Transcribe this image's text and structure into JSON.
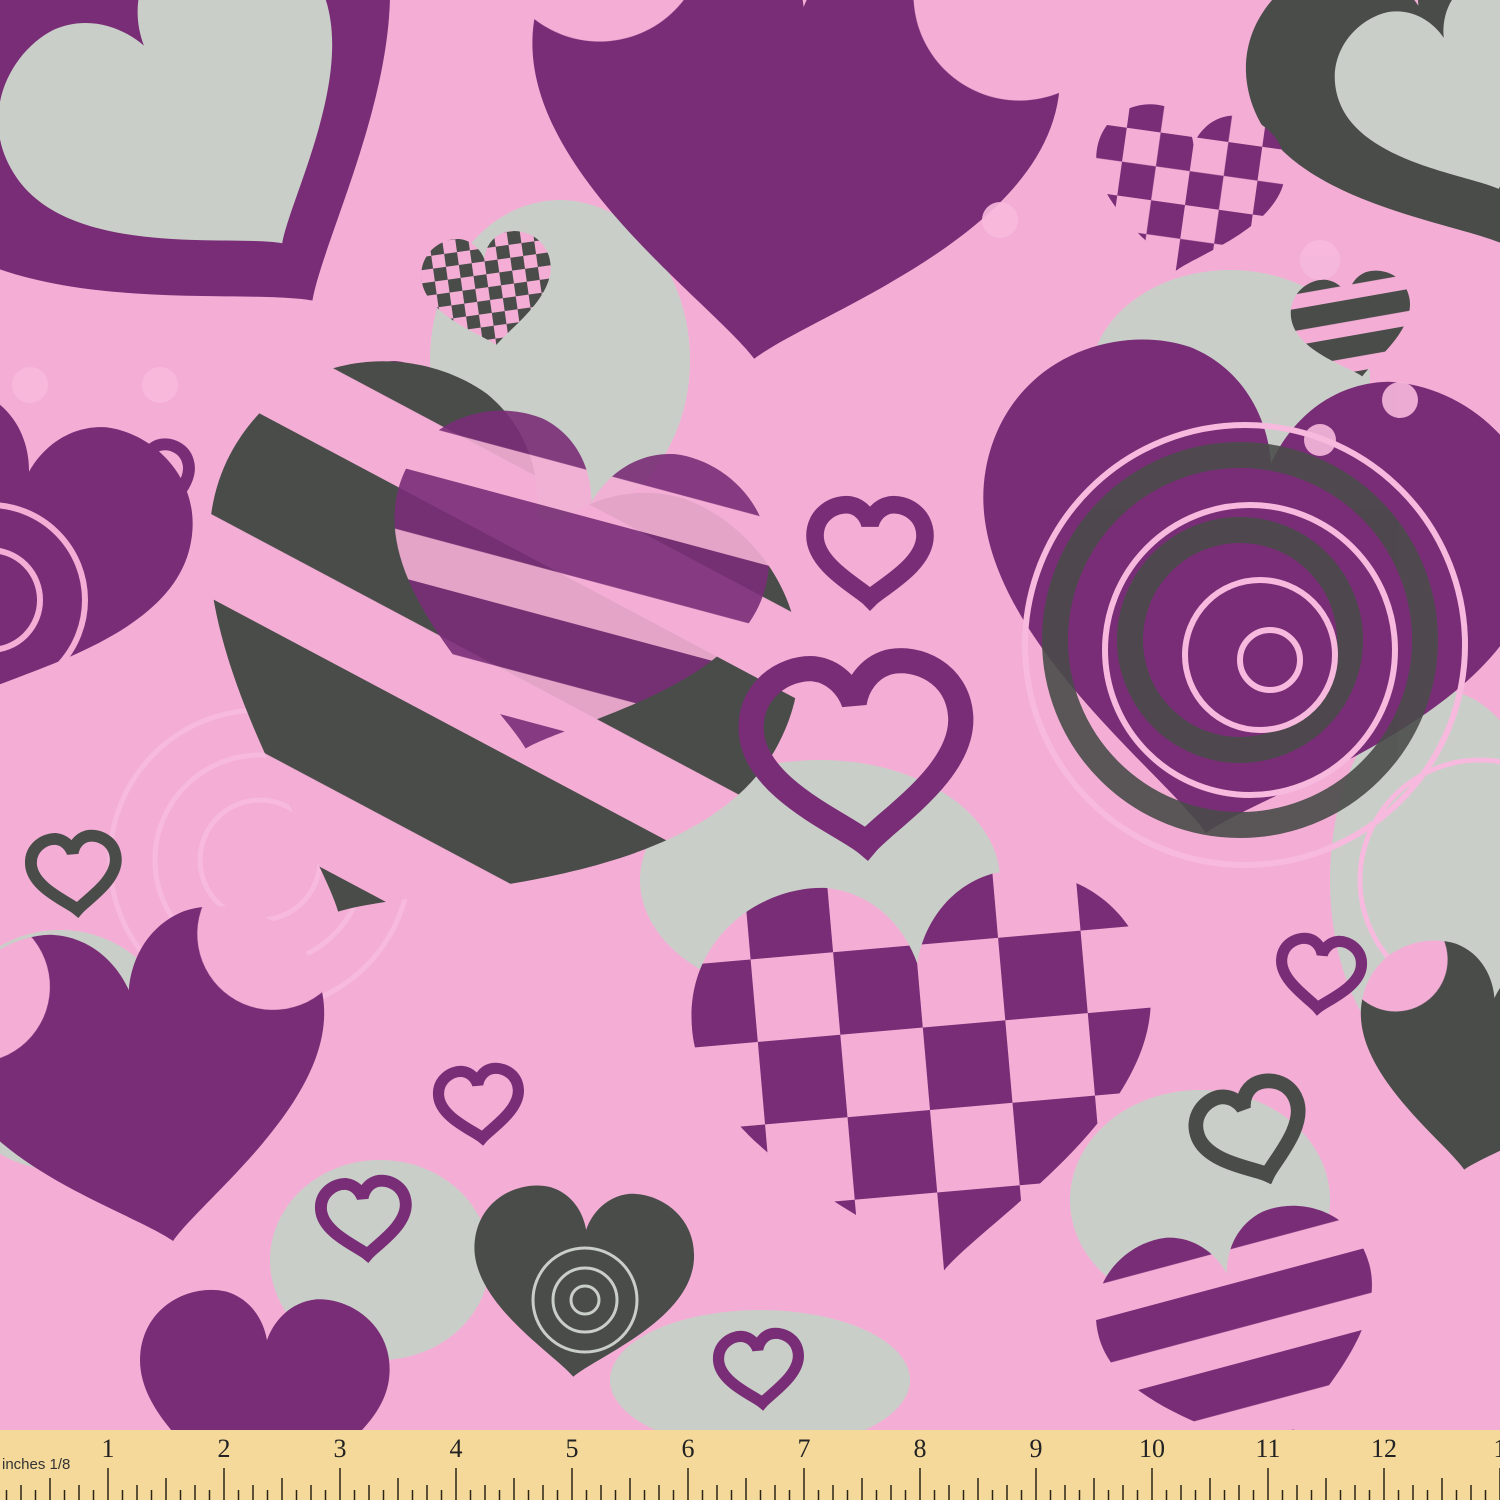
{
  "colors": {
    "background": "#f4aed6",
    "purple": "#7a2d77",
    "gray": "#4a4c4a",
    "light_gray": "#c9cfc8",
    "light_pink": "#f7b9dd",
    "ruler": "#f5d99a",
    "ruler_ink": "#2a2418"
  },
  "ruler": {
    "unit_label": "inches 1/8",
    "numbers": [
      "1",
      "2",
      "3",
      "4",
      "5",
      "6",
      "7",
      "8",
      "9",
      "10",
      "11",
      "12",
      "1"
    ]
  }
}
